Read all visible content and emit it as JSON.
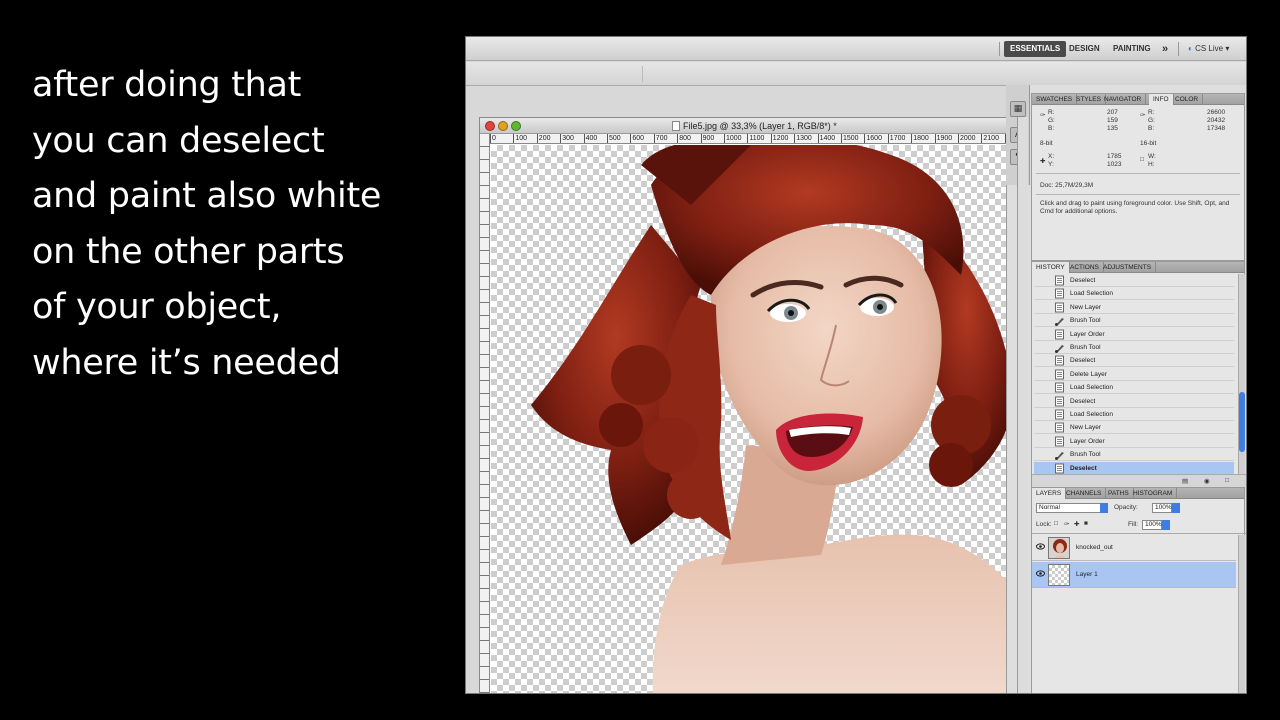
{
  "caption": {
    "lines": [
      "after doing that",
      "you can deselect",
      "and paint also white",
      "on the other parts",
      "of your object,",
      "where it’s needed"
    ]
  },
  "appbar": {
    "workspaces": [
      "ESSENTIALS",
      "DESIGN",
      "PAINTING"
    ],
    "more": "»",
    "cslive": "CS Live"
  },
  "document": {
    "title": "File5.jpg @ 33,3% (Layer 1, RGB/8*) *",
    "ruler_labels": [
      "0",
      "100",
      "200",
      "300",
      "400",
      "500",
      "600",
      "700",
      "800",
      "900",
      "1000",
      "1100",
      "1200",
      "1300",
      "1400",
      "1500",
      "1600",
      "1700",
      "1800",
      "1900",
      "2000",
      "2100",
      "2200",
      "230"
    ]
  },
  "info_panel": {
    "tabs": [
      "SWATCHES",
      "STYLES",
      "NAVIGATOR",
      "INFO",
      "COLOR"
    ],
    "active_tab": "INFO",
    "rgb_left": {
      "R": "207",
      "G": "159",
      "B": "135"
    },
    "rgb_right": {
      "R": "26600",
      "G": "20432",
      "B": "17348"
    },
    "bit_left": "8-bit",
    "bit_right": "16-bit",
    "x": "1785",
    "y": "1023",
    "w": "",
    "h": "",
    "doc": "Doc: 25,7M/29,3M",
    "hint": "Click and drag to paint using foreground color.  Use Shift, Opt, and Cmd for additional options."
  },
  "history_panel": {
    "tabs": [
      "HISTORY",
      "ACTIONS",
      "ADJUSTMENTS"
    ],
    "active_tab": "HISTORY",
    "items": [
      {
        "label": "Deselect",
        "icon": "doc"
      },
      {
        "label": "Load Selection",
        "icon": "doc"
      },
      {
        "label": "New Layer",
        "icon": "doc"
      },
      {
        "label": "Brush Tool",
        "icon": "brush"
      },
      {
        "label": "Layer Order",
        "icon": "doc"
      },
      {
        "label": "Brush Tool",
        "icon": "brush"
      },
      {
        "label": "Deselect",
        "icon": "doc"
      },
      {
        "label": "Delete Layer",
        "icon": "doc"
      },
      {
        "label": "Load Selection",
        "icon": "doc"
      },
      {
        "label": "Deselect",
        "icon": "doc"
      },
      {
        "label": "Load Selection",
        "icon": "doc"
      },
      {
        "label": "New Layer",
        "icon": "doc"
      },
      {
        "label": "Layer Order",
        "icon": "doc"
      },
      {
        "label": "Brush Tool",
        "icon": "brush"
      },
      {
        "label": "Deselect",
        "icon": "doc"
      }
    ],
    "selected_index": 14
  },
  "layers_panel": {
    "tabs": [
      "LAYERS",
      "CHANNELS",
      "PATHS",
      "HISTOGRAM"
    ],
    "active_tab": "LAYERS",
    "blend_mode": "Normal",
    "opacity_label": "Opacity:",
    "opacity": "100%",
    "lock_label": "Lock:",
    "fill_label": "Fill:",
    "fill": "100%",
    "layers": [
      {
        "name": "knocked_out",
        "selected": false
      },
      {
        "name": "Layer 1",
        "selected": true
      }
    ]
  },
  "colors": {
    "selection": "#a9c6f2",
    "accent": "#3f7ee0"
  }
}
